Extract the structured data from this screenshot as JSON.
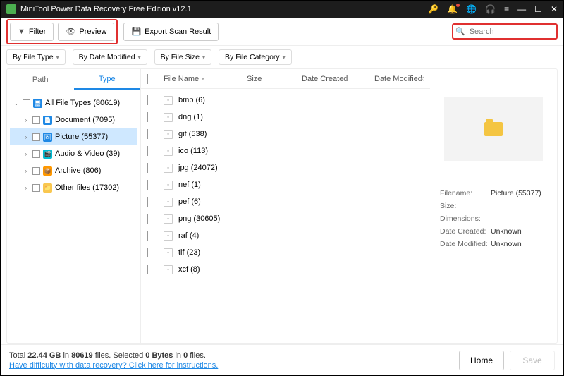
{
  "titlebar": {
    "title": "MiniTool Power Data Recovery Free Edition v12.1"
  },
  "toolbar": {
    "filter": "Filter",
    "preview": "Preview",
    "export": "Export Scan Result",
    "search_placeholder": "Search"
  },
  "filters": {
    "by_type": "By File Type",
    "by_date": "By Date Modified",
    "by_size": "By File Size",
    "by_category": "By File Category"
  },
  "sidebar": {
    "tab_path": "Path",
    "tab_type": "Type",
    "root": "All File Types (80619)",
    "items": [
      {
        "label": "Document (7095)"
      },
      {
        "label": "Picture (55377)"
      },
      {
        "label": "Audio & Video (39)"
      },
      {
        "label": "Archive (806)"
      },
      {
        "label": "Other files (17302)"
      }
    ]
  },
  "columns": {
    "name": "File Name",
    "size": "Size",
    "created": "Date Created",
    "modified": "Date Modified"
  },
  "files": [
    {
      "name": "bmp (6)"
    },
    {
      "name": "dng (1)"
    },
    {
      "name": "gif (538)"
    },
    {
      "name": "ico (113)"
    },
    {
      "name": "jpg (24072)"
    },
    {
      "name": "nef (1)"
    },
    {
      "name": "pef (6)"
    },
    {
      "name": "png (30605)"
    },
    {
      "name": "raf (4)"
    },
    {
      "name": "tif (23)"
    },
    {
      "name": "xcf (8)"
    }
  ],
  "preview": {
    "filename_label": "Filename:",
    "filename": "Picture (55377)",
    "size_label": "Size:",
    "size": "",
    "dim_label": "Dimensions:",
    "dim": "",
    "created_label": "Date Created:",
    "created": "Unknown",
    "modified_label": "Date Modified:",
    "modified": "Unknown"
  },
  "status": {
    "total_prefix": "Total ",
    "total_size": "22.44 GB",
    "total_mid": " in ",
    "total_count": "80619",
    "total_suffix": " files.   Selected ",
    "sel_bytes": "0 Bytes",
    "sel_mid": " in ",
    "sel_count": "0",
    "sel_suffix": " files.",
    "help": "Have difficulty with data recovery? Click here for instructions.",
    "home": "Home",
    "save": "Save"
  }
}
